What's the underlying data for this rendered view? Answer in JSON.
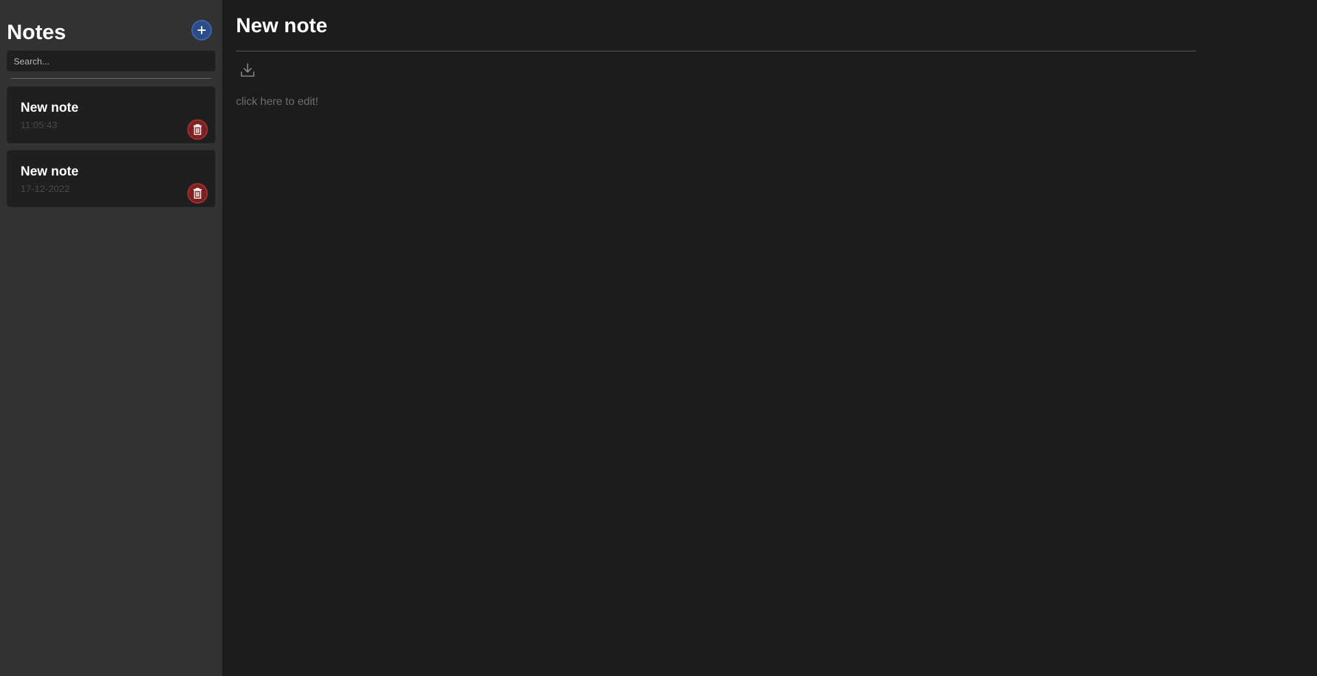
{
  "sidebar": {
    "title": "Notes",
    "add_icon": "plus-icon",
    "search": {
      "placeholder": "Search...",
      "value": ""
    },
    "notes": [
      {
        "title": "New note",
        "date": "11:05:43",
        "delete_icon": "trash-icon"
      },
      {
        "title": "New note",
        "date": "17-12-2022",
        "delete_icon": "trash-icon"
      }
    ]
  },
  "editor": {
    "title": "New note",
    "download_icon": "download-icon",
    "content_placeholder": "click here to edit!"
  },
  "colors": {
    "sidebar_bg": "#323232",
    "main_bg": "#1c1c1c",
    "card_bg": "#1f1f1f",
    "add_button": "#2a4d8a",
    "delete_button": "#7c2020"
  }
}
